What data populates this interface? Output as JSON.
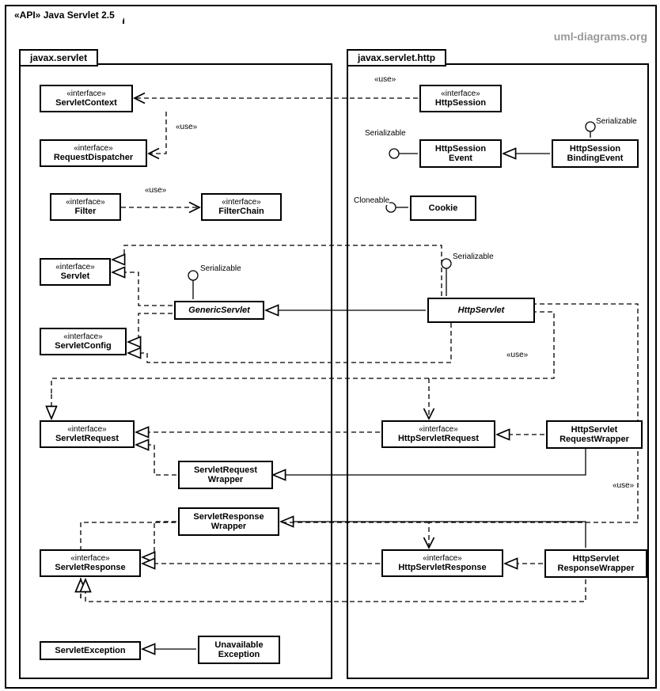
{
  "frame": {
    "stereotype": "«API»",
    "title": "Java Servlet 2.5"
  },
  "watermark": "uml-diagrams.org",
  "packages": {
    "left": "javax.servlet",
    "right": "javax.servlet.http"
  },
  "classes": {
    "ServletContext": {
      "stereo": "«interface»",
      "name": "ServletContext"
    },
    "RequestDispatcher": {
      "stereo": "«interface»",
      "name": "RequestDispatcher"
    },
    "Filter": {
      "stereo": "«interface»",
      "name": "Filter"
    },
    "FilterChain": {
      "stereo": "«interface»",
      "name": "FilterChain"
    },
    "Servlet": {
      "stereo": "«interface»",
      "name": "Servlet"
    },
    "GenericServlet": {
      "name": "GenericServlet"
    },
    "ServletConfig": {
      "stereo": "«interface»",
      "name": "ServletConfig"
    },
    "ServletRequest": {
      "stereo": "«interface»",
      "name": "ServletRequest"
    },
    "ServletRequestWrapper": {
      "name1": "ServletRequest",
      "name2": "Wrapper"
    },
    "ServletResponseWrapper": {
      "name1": "ServletResponse",
      "name2": "Wrapper"
    },
    "ServletResponse": {
      "stereo": "«interface»",
      "name": "ServletResponse"
    },
    "ServletException": {
      "name": "ServletException"
    },
    "UnavailableException": {
      "name1": "Unavailable",
      "name2": "Exception"
    },
    "HttpSession": {
      "stereo": "«interface»",
      "name": "HttpSession"
    },
    "HttpSessionEvent": {
      "name1": "HttpSession",
      "name2": "Event"
    },
    "HttpSessionBindingEvent": {
      "name1": "HttpSession",
      "name2": "BindingEvent"
    },
    "Cookie": {
      "name": "Cookie"
    },
    "HttpServlet": {
      "name": "HttpServlet"
    },
    "HttpServletRequest": {
      "stereo": "«interface»",
      "name": "HttpServletRequest"
    },
    "HttpServletRequestWrapper": {
      "name1": "HttpServlet",
      "name2": "RequestWrapper"
    },
    "HttpServletResponse": {
      "stereo": "«interface»",
      "name": "HttpServletResponse"
    },
    "HttpServletResponseWrapper": {
      "name1": "HttpServlet",
      "name2": "ResponseWrapper"
    }
  },
  "labels": {
    "use": "«use»",
    "Serializable": "Serializable",
    "Cloneable": "Cloneable"
  }
}
